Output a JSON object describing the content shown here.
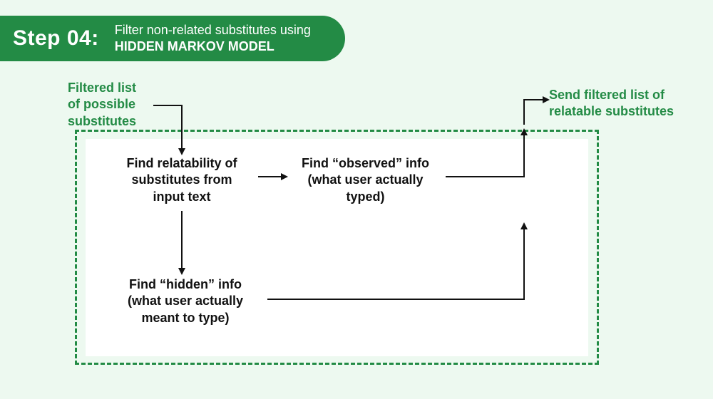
{
  "header": {
    "step": "Step 04:",
    "subtitle": "Filter non-related substitutes using",
    "emphasis": "HIDDEN MARKOV MODEL"
  },
  "labels": {
    "input": "Filtered list\nof possible\nsubstitutes",
    "output": "Send filtered list of\nrelatable substitutes"
  },
  "nodes": {
    "relatability": "Find relatability of\nsubstitutes from\ninput text",
    "observed": "Find “observed” info\n(what user actually\ntyped)",
    "hidden": "Find “hidden” info\n(what user actually\nmeant to type)"
  },
  "colors": {
    "accent": "#238b45",
    "bg": "#edf9f0",
    "panel": "#ffffff",
    "ink": "#111111"
  }
}
